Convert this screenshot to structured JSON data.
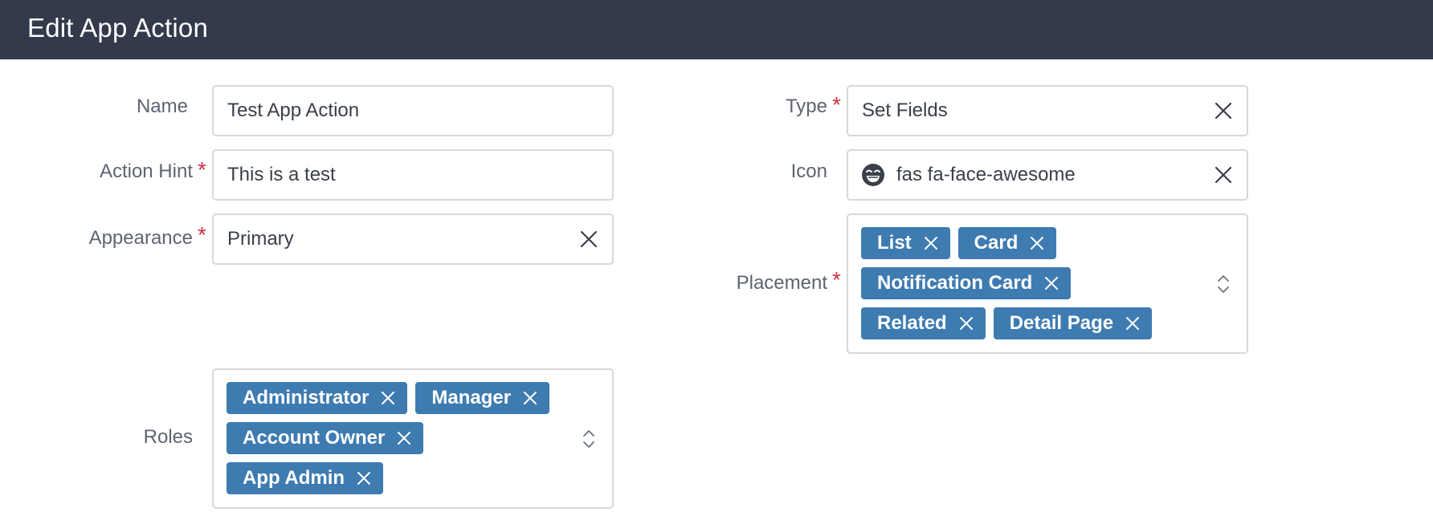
{
  "header": {
    "title": "Edit App Action"
  },
  "colors": {
    "header_bg": "#323a4b",
    "tag_bg": "#3e7bb1",
    "required": "#cc3344"
  },
  "fields": {
    "name": {
      "label": "Name",
      "value": "Test App Action",
      "required": false
    },
    "action_hint": {
      "label": "Action Hint",
      "value": "This is a test",
      "required": true
    },
    "appearance": {
      "label": "Appearance",
      "value": "Primary",
      "required": true
    },
    "type": {
      "label": "Type",
      "value": "Set Fields",
      "required": true
    },
    "icon": {
      "label": "Icon",
      "value": "fas fa-face-awesome",
      "icon_name": "face-awesome-icon",
      "required": false
    },
    "placement": {
      "label": "Placement",
      "required": true,
      "tags": [
        "List",
        "Card",
        "Notification Card",
        "Related",
        "Detail Page"
      ]
    },
    "roles": {
      "label": "Roles",
      "required": false,
      "tags": [
        "Administrator",
        "Manager",
        "Account Owner",
        "App Admin"
      ]
    }
  },
  "required_marker": "*"
}
